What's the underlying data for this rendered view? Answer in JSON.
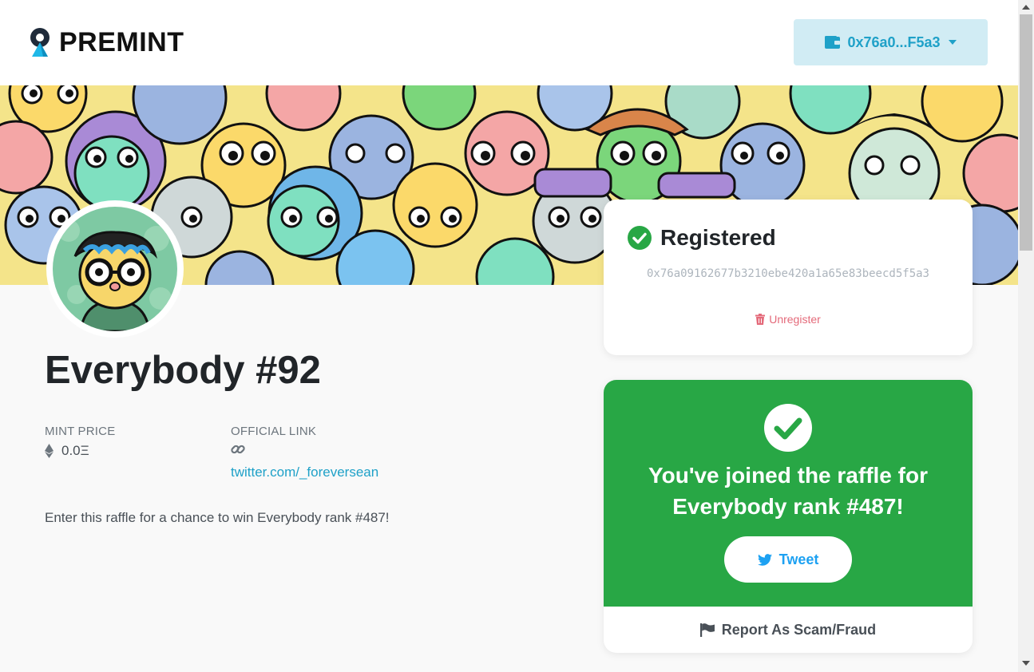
{
  "navbar": {
    "logo_text": "PREMINT",
    "wallet_label": "0x76a0...F5a3"
  },
  "project": {
    "title": "Everybody #92",
    "mint_price_label": "MINT PRICE",
    "mint_price_value": "0.0Ξ",
    "official_link_label": "OFFICIAL LINK",
    "official_link_text": "twitter.com/_foreversean",
    "description": "Enter this raffle for a chance to win Everybody rank #487!"
  },
  "registration": {
    "title": "Registered",
    "address": "0x76a09162677b3210ebe420a1a65e83beecd5f5a3",
    "unregister_label": "Unregister"
  },
  "raffle": {
    "joined_text": "You've joined the raffle for Everybody rank #487!",
    "tweet_label": "Tweet",
    "report_label": "Report As Scam/Fraud"
  },
  "colors": {
    "accent": "#1fa1c8",
    "success": "#28a745",
    "danger_text": "#e46a7a",
    "twitter": "#1da1f2"
  },
  "icons": [
    "wallet-icon",
    "ethereum-icon",
    "link-icon",
    "check-circle-icon",
    "trash-icon",
    "twitter-icon",
    "flag-icon"
  ]
}
